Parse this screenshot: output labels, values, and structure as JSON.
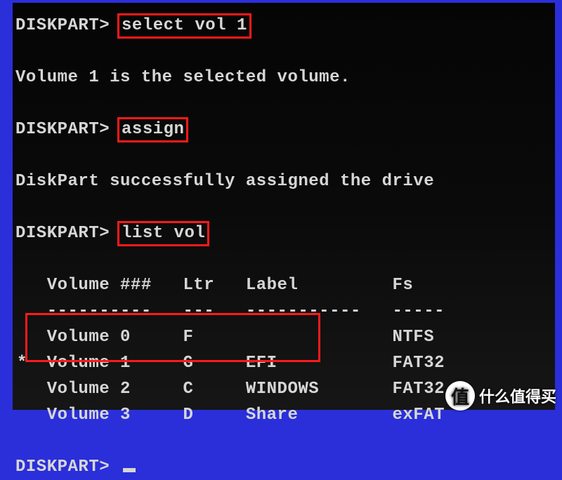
{
  "prompt": "DISKPART>",
  "commands": {
    "c1": "select vol 1",
    "c2": "assign",
    "c3": "list vol"
  },
  "responses": {
    "r1": "Volume 1 is the selected volume.",
    "r2": "DiskPart successfully assigned the drive"
  },
  "table": {
    "headers": {
      "vol": "Volume ###",
      "ltr": "Ltr",
      "label": "Label",
      "fs": "Fs"
    },
    "dashes": {
      "vol": "----------",
      "ltr": "---",
      "label": "-----------",
      "fs": "-----"
    },
    "rows": [
      {
        "selected": false,
        "vol": "Volume 0",
        "ltr": "F",
        "label": "",
        "fs": "NTFS"
      },
      {
        "selected": true,
        "vol": "Volume 1",
        "ltr": "G",
        "label": "EFI",
        "fs": "FAT32"
      },
      {
        "selected": false,
        "vol": "Volume 2",
        "ltr": "C",
        "label": "WINDOWS",
        "fs": "FAT32"
      },
      {
        "selected": false,
        "vol": "Volume 3",
        "ltr": "D",
        "label": "Share",
        "fs": "exFAT"
      }
    ]
  },
  "watermark": {
    "badge": "值",
    "text": "什么值得买"
  },
  "colors": {
    "highlight": "#ff1a1a",
    "bg_outer": "#2a2fd9",
    "bg_inner": "#0a0a0a",
    "fg": "#d6d6d6"
  }
}
